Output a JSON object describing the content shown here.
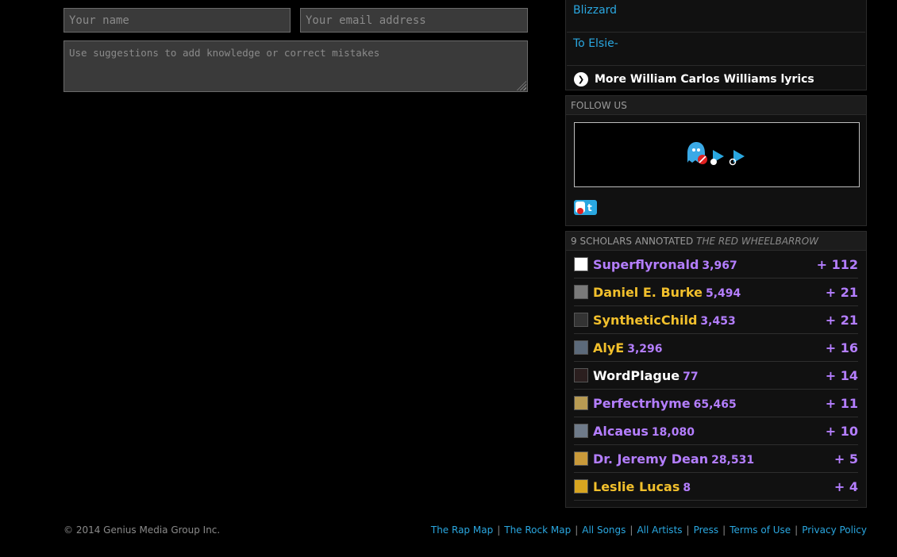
{
  "form": {
    "name_placeholder": "Your name",
    "email_placeholder": "Your email address",
    "suggestion_placeholder": "Use suggestions to add knowledge or correct mistakes"
  },
  "related": {
    "links": [
      "Blizzard",
      "To Elsie-"
    ],
    "more_label": "More William Carlos Williams lyrics",
    "more_icon": "chevron-right-icon"
  },
  "follow": {
    "header": "FOLLOW US",
    "icons": [
      "ghost-icon",
      "play-arrow-icon",
      "play-arrow-icon"
    ]
  },
  "scholars": {
    "header_prefix": "9 SCHOLARS ANNOTATED",
    "header_song": "THE RED WHEELBARROW",
    "list": [
      {
        "name": "Superflyronald",
        "iq": "3,967",
        "score": "+ 112",
        "color": "#b47eff"
      },
      {
        "name": "Daniel E. Burke",
        "iq": "5,494",
        "score": "+ 21",
        "color": "#f2c02c"
      },
      {
        "name": "SyntheticChild",
        "iq": "3,453",
        "score": "+ 21",
        "color": "#f2c02c"
      },
      {
        "name": "AlyE",
        "iq": "3,296",
        "score": "+ 16",
        "color": "#f2c02c"
      },
      {
        "name": "WordPlague",
        "iq": "77",
        "score": "+ 14",
        "color": "#ffffff"
      },
      {
        "name": "Perfectrhyme",
        "iq": "65,465",
        "score": "+ 11",
        "color": "#b47eff"
      },
      {
        "name": "Alcaeus",
        "iq": "18,080",
        "score": "+ 10",
        "color": "#b47eff"
      },
      {
        "name": "Dr. Jeremy Dean",
        "iq": "28,531",
        "score": "+ 5",
        "color": "#b47eff"
      },
      {
        "name": "Leslie Lucas",
        "iq": "8",
        "score": "+ 4",
        "color": "#f2c02c"
      }
    ]
  },
  "footer": {
    "copyright": "© 2014 Genius Media Group Inc.",
    "links": [
      "The Rap Map",
      "The Rock Map",
      "All Songs",
      "All Artists",
      "Press",
      "Terms of Use",
      "Privacy Policy"
    ]
  },
  "colors": {
    "link": "#2aa7e0",
    "iq_purple": "#b47eff",
    "gold": "#f2c02c"
  }
}
